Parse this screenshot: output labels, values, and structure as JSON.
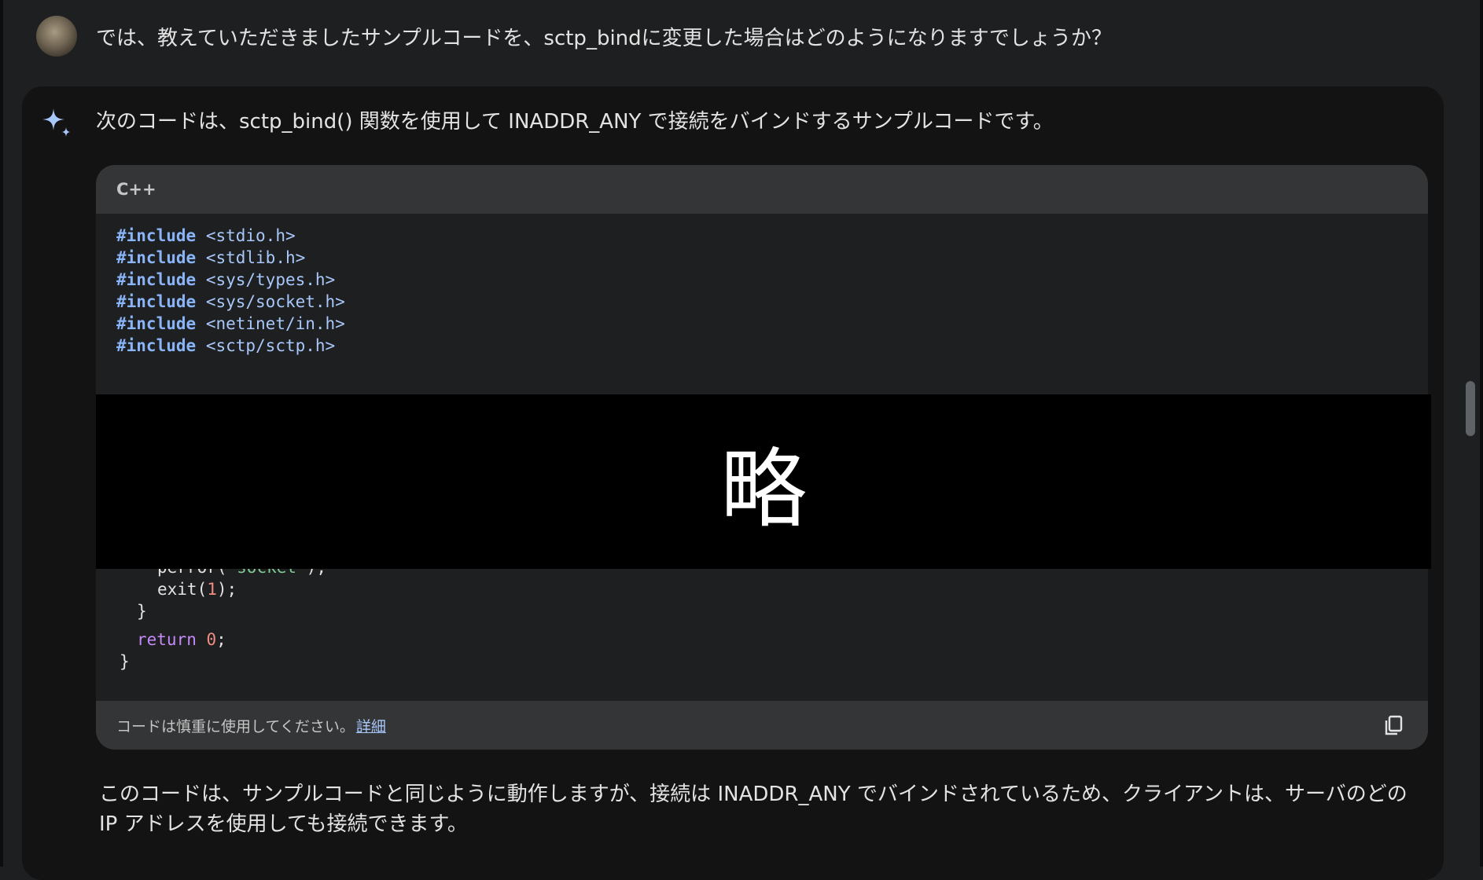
{
  "user": {
    "prompt": "では、教えていただきましたサンプルコードを、sctp_bindに変更した場合はどのようになりますでしょうか？"
  },
  "response": {
    "intro": "次のコードは、sctp_bind() 関数を使用して INADDR_ANY で接続をバインドするサンプルコードです。",
    "code_language": "C++",
    "code": {
      "includes": [
        {
          "kw": "#include",
          "header": "<stdio.h>"
        },
        {
          "kw": "#include",
          "header": "<stdlib.h>"
        },
        {
          "kw": "#include",
          "header": "<sys/types.h>"
        },
        {
          "kw": "#include",
          "header": "<sys/socket.h>"
        },
        {
          "kw": "#include",
          "header": "<netinet/in.h>"
        },
        {
          "kw": "#include",
          "header": "<sctp/sctp.h>"
        }
      ],
      "perror_fn": "perror(",
      "perror_arg": "\"socket\"",
      "perror_end": ");",
      "exit_fn": "exit(",
      "exit_arg": "1",
      "exit_end": ");",
      "close_brace_inner": "}",
      "return_kw": "return",
      "return_val": "0",
      "return_end": ";",
      "close_brace_outer": "}"
    },
    "redaction_label": "略",
    "footer_text": "コードは慎重に使用してください。",
    "footer_link": "詳細",
    "outro": "このコードは、サンプルコードと同じように動作しますが、接続は INADDR_ANY でバインドされているため、クライアントは、サーバのどの IP アドレスを使用しても接続できます。"
  },
  "icons": {
    "response_icon": "sparkle-icon",
    "copy_icon": "copy-icon"
  },
  "colors": {
    "background": "#1e1f20",
    "response_bg": "#131314",
    "accent": "#a8c7fa"
  }
}
